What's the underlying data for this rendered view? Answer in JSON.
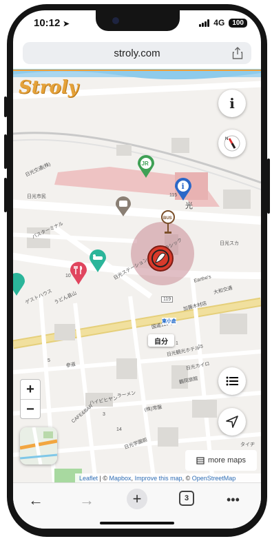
{
  "status": {
    "time": "10:12",
    "network": "4G",
    "battery": "100"
  },
  "browser": {
    "url": "stroly.com"
  },
  "map": {
    "logo": "Stroly",
    "self_label": "自分",
    "more_maps": "more maps",
    "zoom_in": "+",
    "zoom_out": "−",
    "attribution": {
      "leaflet": "Leaflet",
      "sep1": " | © ",
      "mapbox": "Mapbox",
      "sep2": ", ",
      "improve": "Improve this map",
      "sep3": ", © ",
      "osm": "OpenStreetMap"
    },
    "labels": {
      "station_number": "123",
      "hikari": "光",
      "nikko_sta": "日光スカ",
      "bus_terminal": "バスターミナル",
      "hotel": "日光ステーション\nホテルクラシック",
      "earthes": "Earthe's",
      "daikaku": "大和交通",
      "guesthouse": "ゲストハウス",
      "udon": "うどん县山",
      "shimin": "日光市民",
      "kato": "加藤木材店",
      "route_119": "119",
      "route_name": "国道119号",
      "higashi": "東小倉",
      "nikko_kanko": "日光観光ホテル",
      "nikko_shoji": "日光カイロ",
      "tsuruga": "鶴岡旅館",
      "sando": "参道",
      "haibiya": "ハイビヒヤン",
      "ramen": "ラーメン",
      "cafe": "CAFE&BAR",
      "nikko_gakuen": "日光学園前",
      "tuji": "タイヂ",
      "sakae": "(株)常盤",
      "nikko_jr_area": "日光交通(株)",
      "num_115": "115",
      "num_10": "10",
      "num_5a": "5",
      "num_1": "1",
      "num_15": "15",
      "num_3": "3",
      "num_14": "14"
    }
  },
  "toolbar": {
    "tabs_count": "3"
  }
}
